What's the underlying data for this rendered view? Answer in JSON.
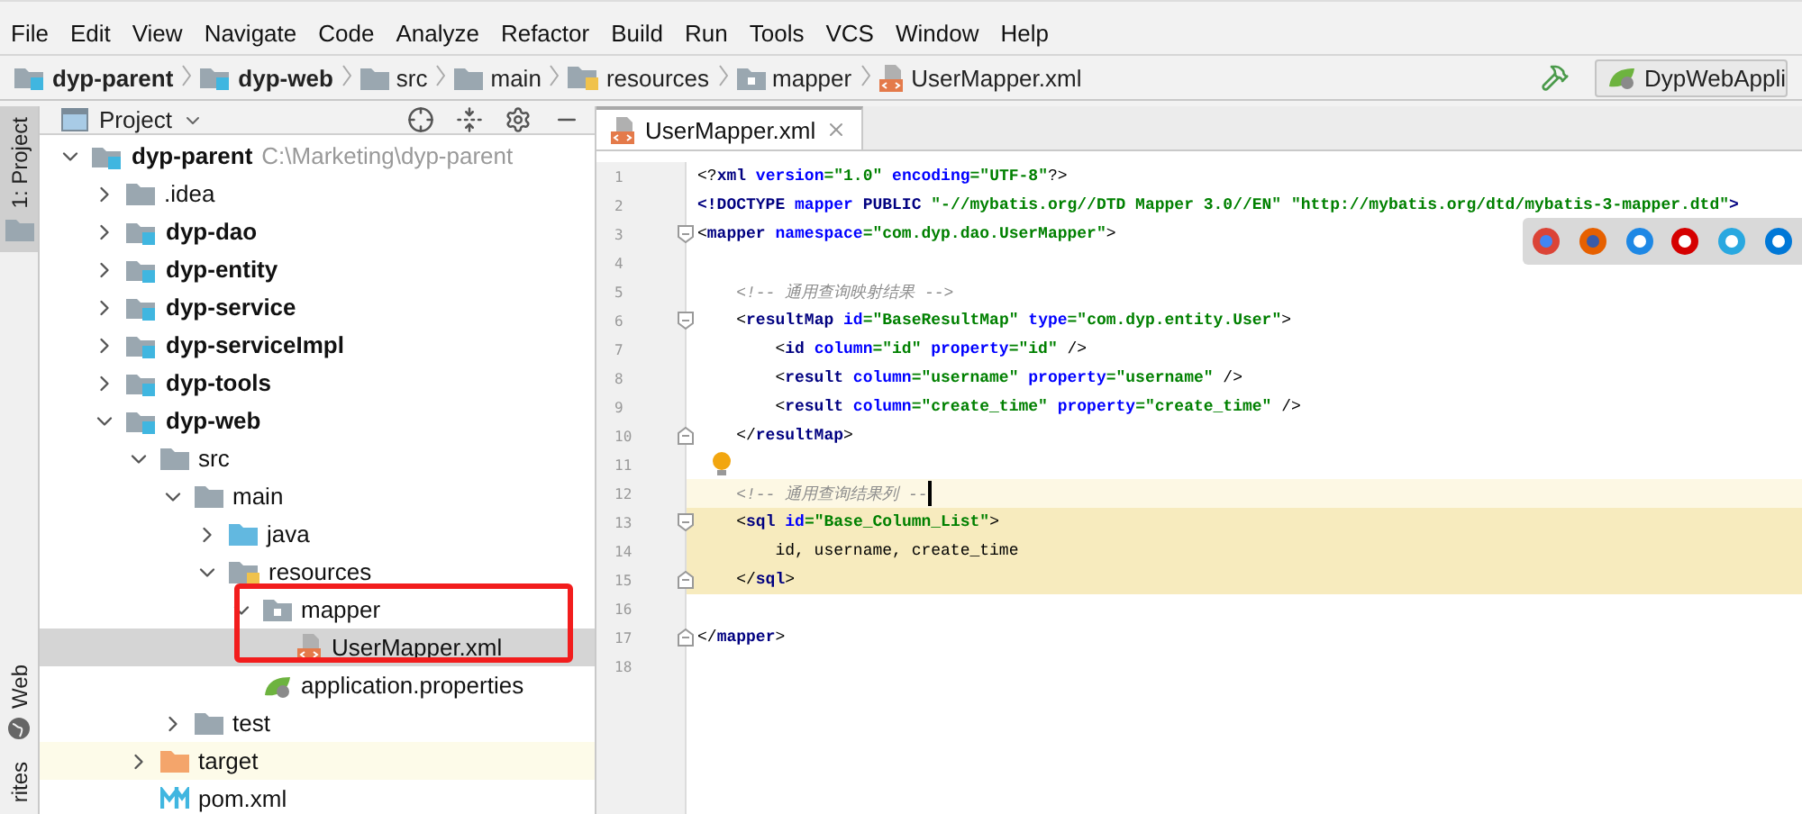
{
  "menu": [
    "File",
    "Edit",
    "View",
    "Navigate",
    "Code",
    "Analyze",
    "Refactor",
    "Build",
    "Run",
    "Tools",
    "VCS",
    "Window",
    "Help"
  ],
  "breadcrumbs": [
    {
      "label": "dyp-parent",
      "kind": "module"
    },
    {
      "label": "dyp-web",
      "kind": "module"
    },
    {
      "label": "src",
      "kind": "folder"
    },
    {
      "label": "main",
      "kind": "folder"
    },
    {
      "label": "resources",
      "kind": "resources"
    },
    {
      "label": "mapper",
      "kind": "package"
    },
    {
      "label": "UserMapper.xml",
      "kind": "xml"
    }
  ],
  "run_config": "DypWebAppli",
  "side_tabs": [
    {
      "label": "1: Project",
      "selected": true,
      "kind": "folder"
    },
    {
      "label": "Web",
      "selected": false,
      "kind": "globe"
    },
    {
      "label": "rites",
      "selected": false,
      "kind": "none"
    }
  ],
  "project_panel": {
    "title": "Project",
    "tree": [
      {
        "label": "dyp-parent",
        "hint": "C:\\Marketing\\dyp-parent",
        "kind": "module",
        "expanded": true,
        "selected": false,
        "children": [
          {
            "label": ".idea",
            "kind": "folder",
            "expanded": false,
            "selected": false
          },
          {
            "label": "dyp-dao",
            "kind": "module",
            "expanded": false,
            "selected": false
          },
          {
            "label": "dyp-entity",
            "kind": "module",
            "expanded": false,
            "selected": false
          },
          {
            "label": "dyp-service",
            "kind": "module",
            "expanded": false,
            "selected": false
          },
          {
            "label": "dyp-serviceImpl",
            "kind": "module",
            "expanded": false,
            "selected": false
          },
          {
            "label": "dyp-tools",
            "kind": "module",
            "expanded": false,
            "selected": false
          },
          {
            "label": "dyp-web",
            "kind": "module",
            "expanded": true,
            "selected": false,
            "children": [
              {
                "label": "src",
                "kind": "folder",
                "expanded": true,
                "selected": false,
                "children": [
                  {
                    "label": "main",
                    "kind": "folder",
                    "expanded": true,
                    "selected": false,
                    "children": [
                      {
                        "label": "java",
                        "kind": "source",
                        "expanded": false,
                        "selected": false
                      },
                      {
                        "label": "resources",
                        "kind": "resources",
                        "expanded": true,
                        "selected": false,
                        "children": [
                          {
                            "label": "mapper",
                            "kind": "package",
                            "expanded": true,
                            "selected": false,
                            "children": [
                              {
                                "label": "UserMapper.xml",
                                "kind": "xml",
                                "selected": true
                              }
                            ]
                          },
                          {
                            "label": "application.properties",
                            "kind": "spring",
                            "selected": false
                          }
                        ]
                      }
                    ]
                  },
                  {
                    "label": "test",
                    "kind": "folder",
                    "expanded": false,
                    "selected": false
                  }
                ]
              },
              {
                "label": "target",
                "kind": "excluded",
                "expanded": false,
                "selected": false
              },
              {
                "label": "pom.xml",
                "kind": "maven",
                "selected": false
              }
            ]
          }
        ]
      }
    ]
  },
  "editor": {
    "tabs": [
      {
        "label": "UserMapper.xml",
        "selected": true
      }
    ],
    "lines": [
      {
        "number": "1",
        "tokens": [
          {
            "kind": "punct",
            "text": "<?"
          },
          {
            "kind": "tag",
            "text": "xml "
          },
          {
            "kind": "attr",
            "text": "version"
          },
          {
            "kind": "value",
            "text": "=\"1.0\" "
          },
          {
            "kind": "attr",
            "text": "encoding"
          },
          {
            "kind": "value",
            "text": "=\"UTF-8\""
          },
          {
            "kind": "punct",
            "text": "?>"
          }
        ]
      },
      {
        "number": "2",
        "tokens": [
          {
            "kind": "tag",
            "text": "<!DOCTYPE "
          },
          {
            "kind": "attr",
            "text": "mapper "
          },
          {
            "kind": "tag",
            "text": "PUBLIC "
          },
          {
            "kind": "value",
            "text": "\"-//mybatis.org//DTD Mapper 3.0//EN\" \"http://mybatis.org/dtd/mybatis-3-mapper.dtd\""
          },
          {
            "kind": "tag",
            "text": ">"
          }
        ]
      },
      {
        "number": "3",
        "fold_open": true,
        "tokens": [
          {
            "kind": "punct",
            "text": "<"
          },
          {
            "kind": "tag",
            "text": "mapper "
          },
          {
            "kind": "attr",
            "text": "namespace"
          },
          {
            "kind": "value",
            "text": "=\"com.dyp.dao.UserMapper\""
          },
          {
            "kind": "punct",
            "text": ">"
          }
        ]
      },
      {
        "number": "4"
      },
      {
        "number": "5",
        "tokens": [
          {
            "kind": "comment",
            "text": "    <!-- 通用查询映射结果 -->"
          }
        ]
      },
      {
        "number": "6",
        "fold_open": true,
        "tokens": [
          {
            "kind": "punct",
            "text": "    <"
          },
          {
            "kind": "tag",
            "text": "resultMap "
          },
          {
            "kind": "attr",
            "text": "id"
          },
          {
            "kind": "value",
            "text": "=\"BaseResultMap\" "
          },
          {
            "kind": "attr",
            "text": "type"
          },
          {
            "kind": "value",
            "text": "=\"com.dyp.entity.User\""
          },
          {
            "kind": "punct",
            "text": ">"
          }
        ]
      },
      {
        "number": "7",
        "tokens": [
          {
            "kind": "punct",
            "text": "        <"
          },
          {
            "kind": "tag",
            "text": "id "
          },
          {
            "kind": "attr",
            "text": "column"
          },
          {
            "kind": "value",
            "text": "=\"id\" "
          },
          {
            "kind": "attr",
            "text": "property"
          },
          {
            "kind": "value",
            "text": "=\"id\" "
          },
          {
            "kind": "punct",
            "text": "/>"
          }
        ]
      },
      {
        "number": "8",
        "tokens": [
          {
            "kind": "punct",
            "text": "        <"
          },
          {
            "kind": "tag",
            "text": "result "
          },
          {
            "kind": "attr",
            "text": "column"
          },
          {
            "kind": "value",
            "text": "=\"username\" "
          },
          {
            "kind": "attr",
            "text": "property"
          },
          {
            "kind": "value",
            "text": "=\"username\" "
          },
          {
            "kind": "punct",
            "text": "/>"
          }
        ]
      },
      {
        "number": "9",
        "tokens": [
          {
            "kind": "punct",
            "text": "        <"
          },
          {
            "kind": "tag",
            "text": "result "
          },
          {
            "kind": "attr",
            "text": "column"
          },
          {
            "kind": "value",
            "text": "=\"create_time\" "
          },
          {
            "kind": "attr",
            "text": "property"
          },
          {
            "kind": "value",
            "text": "=\"create_time\" "
          },
          {
            "kind": "punct",
            "text": "/>"
          }
        ]
      },
      {
        "number": "10",
        "fold_close": true,
        "tokens": [
          {
            "kind": "punct",
            "text": "    </"
          },
          {
            "kind": "tag",
            "text": "resultMap"
          },
          {
            "kind": "punct",
            "text": ">"
          }
        ]
      },
      {
        "number": "11",
        "bulb": true
      },
      {
        "number": "12",
        "current": true,
        "caret": true,
        "tokens": [
          {
            "kind": "comment",
            "text": "    <!-- 通用查询结果列 --"
          }
        ]
      },
      {
        "number": "13",
        "fold_open": true,
        "matched": true,
        "tokens": [
          {
            "kind": "punct",
            "text": "    <"
          },
          {
            "kind": "tag",
            "text": "sql "
          },
          {
            "kind": "attr",
            "text": "id"
          },
          {
            "kind": "value",
            "text": "=\"Base_Column_List\""
          },
          {
            "kind": "punct",
            "text": ">"
          }
        ]
      },
      {
        "number": "14",
        "matched": true,
        "tokens": [
          {
            "kind": "text",
            "text": "        id, username, create_time"
          }
        ]
      },
      {
        "number": "15",
        "fold_close": true,
        "matched": true,
        "tokens": [
          {
            "kind": "punct",
            "text": "    </"
          },
          {
            "kind": "tag",
            "text": "sql"
          },
          {
            "kind": "punct",
            "text": ">"
          }
        ]
      },
      {
        "number": "16"
      },
      {
        "number": "17",
        "fold_close": true,
        "tokens": [
          {
            "kind": "punct",
            "text": "</"
          },
          {
            "kind": "tag",
            "text": "mapper"
          },
          {
            "kind": "punct",
            "text": ">"
          }
        ]
      },
      {
        "number": "18"
      }
    ]
  }
}
